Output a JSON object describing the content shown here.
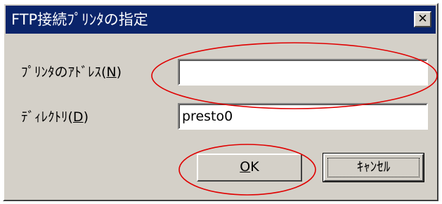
{
  "dialog": {
    "title": "FTP接続ﾌﾟﾘﾝﾀの指定",
    "close_label": "✕"
  },
  "fields": {
    "address": {
      "label_pre": "ﾌﾟﾘﾝﾀのｱﾄﾞﾚｽ(",
      "label_key": "N",
      "label_post": ")",
      "value": ""
    },
    "directory": {
      "label_pre": "ﾃﾞｨﾚｸﾄﾘ(",
      "label_key": "D",
      "label_post": ")",
      "value": "presto0"
    }
  },
  "buttons": {
    "ok_key": "O",
    "ok_rest": "K",
    "cancel_label": "ｷｬﾝｾﾙ"
  },
  "colors": {
    "titlebar": "#0a246a",
    "highlight_ellipse": "#e00000",
    "face": "#d4d0c8"
  }
}
